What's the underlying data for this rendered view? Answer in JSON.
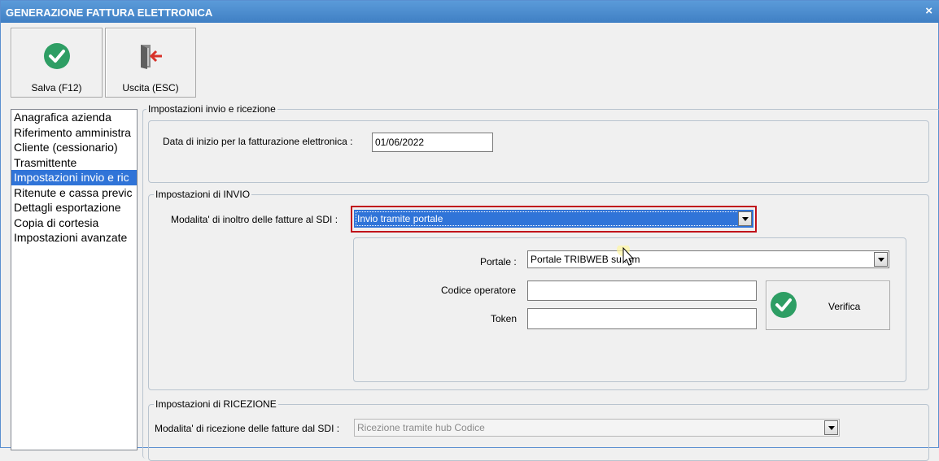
{
  "window": {
    "title": "GENERAZIONE FATTURA ELETTRONICA",
    "close_glyph": "×"
  },
  "toolbar": {
    "save_label": "Salva (F12)",
    "exit_label": "Uscita (ESC)"
  },
  "nav": {
    "items": [
      "Anagrafica azienda",
      "Riferimento amministra",
      "Cliente (cessionario)",
      "Trasmittente",
      "Impostazioni invio e ric",
      "Ritenute e cassa previc",
      "Dettagli esportazione",
      "Copia di cortesia",
      "Impostazioni avanzate"
    ],
    "selected_index": 4
  },
  "main": {
    "outer_group": "Impostazioni invio e ricezione",
    "start_date_label": "Data di inizio per la fatturazione elettronica :",
    "start_date_value": "01/06/2022",
    "invio": {
      "legend": "Impostazioni di INVIO",
      "modalita_label": "Modalita' di inoltro delle fatture al SDI :",
      "modalita_value": "Invio tramite portale",
      "portale_label": "Portale :",
      "portale_value": "Portale TRIBWEB su .sm",
      "codice_label": "Codice operatore",
      "codice_value": "",
      "token_label": "Token",
      "token_value": "",
      "verifica_label": "Verifica"
    },
    "ricezione": {
      "legend": "Impostazioni di RICEZIONE",
      "modalita_label": "Modalita' di ricezione delle fatture dal SDI :",
      "modalita_value": "Ricezione tramite hub Codice"
    }
  },
  "colors": {
    "title_bar": "#4a8bcf",
    "selection": "#3074d8",
    "check_green": "#2e9e64",
    "highlight_border": "#c0101a"
  }
}
